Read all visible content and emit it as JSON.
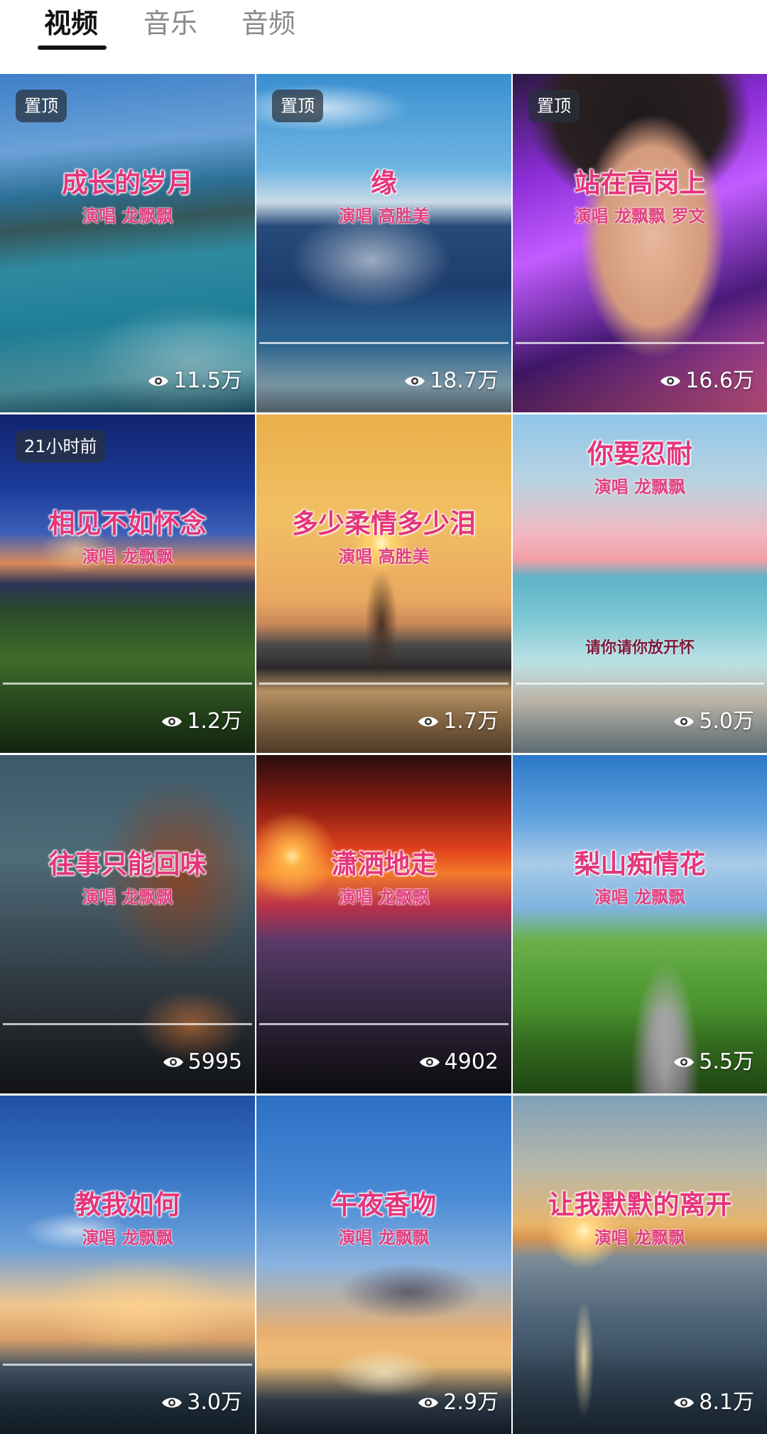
{
  "tabs": [
    {
      "label": "视频",
      "active": true
    },
    {
      "label": "音乐",
      "active": false
    },
    {
      "label": "音频",
      "active": false
    }
  ],
  "colors": {
    "title_pink": "#e5357a",
    "tab_active": "#111111",
    "tab_inactive": "#8a8a8a"
  },
  "videos": [
    {
      "badge": "置顶",
      "title": "成长的岁月",
      "subtitle": "演唱 龙飘飘",
      "caption": "",
      "views": "11.5万"
    },
    {
      "badge": "置顶",
      "title": "缘",
      "subtitle": "演唱 高胜美",
      "caption": "",
      "views": "18.7万"
    },
    {
      "badge": "置顶",
      "title": "站在高岗上",
      "subtitle": "演唱 龙飘飘 罗文",
      "caption": "",
      "views": "16.6万"
    },
    {
      "badge": "21小时前",
      "title": "相见不如怀念",
      "subtitle": "演唱 龙飘飘",
      "caption": "",
      "views": "1.2万"
    },
    {
      "badge": "",
      "title": "多少柔情多少泪",
      "subtitle": "演唱 高胜美",
      "caption": "",
      "views": "1.7万"
    },
    {
      "badge": "",
      "title": "你要忍耐",
      "subtitle": "演唱 龙飘飘",
      "caption": "请你请你放开怀",
      "views": "5.0万"
    },
    {
      "badge": "",
      "title": "往事只能回味",
      "subtitle": "演唱 龙飘飘",
      "caption": "",
      "views": "5995"
    },
    {
      "badge": "",
      "title": "潇洒地走",
      "subtitle": "演唱 龙飘飘",
      "caption": "",
      "views": "4902"
    },
    {
      "badge": "",
      "title": "梨山痴情花",
      "subtitle": "演唱 龙飘飘",
      "caption": "",
      "views": "5.5万"
    },
    {
      "badge": "",
      "title": "教我如何",
      "subtitle": "演唱 龙飘飘",
      "caption": "",
      "views": "3.0万"
    },
    {
      "badge": "",
      "title": "午夜香吻",
      "subtitle": "演唱 龙飘飘",
      "caption": "",
      "views": "2.9万"
    },
    {
      "badge": "",
      "title": "让我默默的离开",
      "subtitle": "演唱 龙飘飘",
      "caption": "",
      "views": "8.1万"
    }
  ]
}
